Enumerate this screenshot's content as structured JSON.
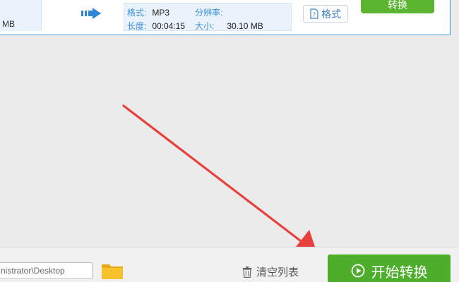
{
  "file_row": {
    "source_size": "MB",
    "format_label": "格式:",
    "format_value": "MP3",
    "resolution_label": "分辨率:",
    "resolution_value": "",
    "duration_label": "长度:",
    "duration_value": "00:04:15",
    "size_label": "大小:",
    "size_value": "30.10 MB",
    "format_button": "格式",
    "convert_button": "转换"
  },
  "bottom_bar": {
    "output_path": "nistrator\\Desktop",
    "clear_list": "清空列表",
    "start_convert": "开始转换"
  },
  "colors": {
    "accent_blue": "#3b8fd6",
    "convert_green": "#4dae2c",
    "annotation_red": "#e8403c",
    "folder_yellow": "#f6c12a"
  },
  "icons": {
    "convert_arrow": "convert-arrow-icon",
    "doc": "doc-icon",
    "folder": "folder-icon",
    "trash": "trash-icon",
    "play": "play-circle-icon",
    "annotation": "red-arrow-annotation"
  }
}
